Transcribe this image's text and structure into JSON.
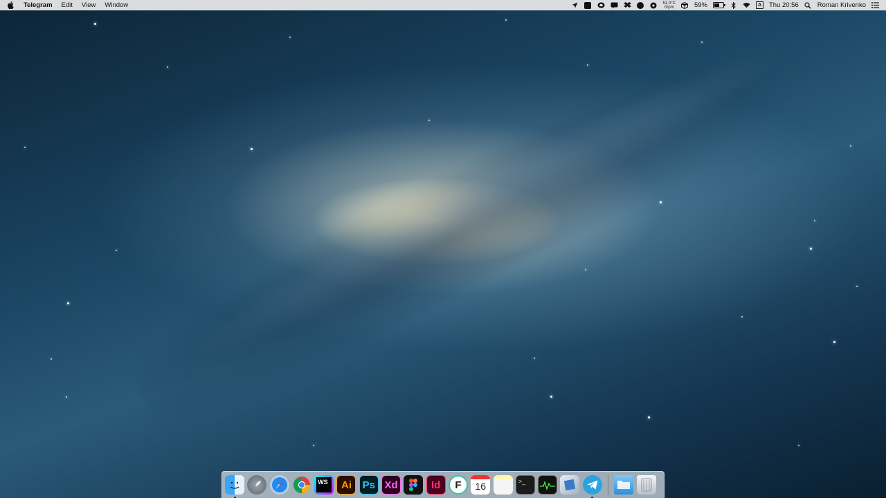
{
  "menubar": {
    "app_name": "Telegram",
    "menus": [
      "Edit",
      "View",
      "Window"
    ],
    "temperature": "51.0°C",
    "fan": "0rpm",
    "battery_percent": "59%",
    "battery_level": 0.59,
    "ime_label": "A",
    "clock": "Thu 20:56",
    "user_name": "Roman Krivenko"
  },
  "dock": {
    "calendar_day": "16",
    "chrome_colors": {
      "red": "#db4437",
      "yellow": "#f4b400",
      "green": "#0f9d58",
      "blue": "#4285f4"
    },
    "ws_label": "WS",
    "ai_label": "Ai",
    "ps_label": "Ps",
    "xd_label": "Xd",
    "id_label": "Id",
    "fontbase_label": "F",
    "terminal_label": ">_"
  }
}
